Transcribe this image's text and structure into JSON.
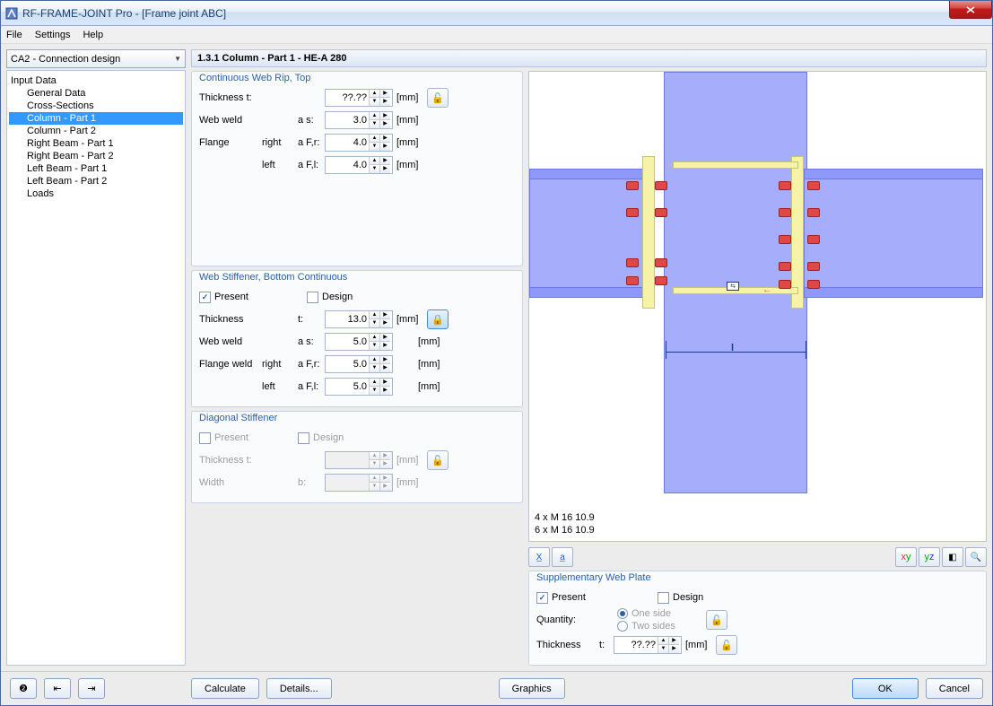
{
  "window": {
    "title": "RF-FRAME-JOINT Pro - [Frame joint ABC]"
  },
  "menu": {
    "file": "File",
    "settings": "Settings",
    "help": "Help"
  },
  "sidebar": {
    "combo": "CA2 - Connection design",
    "root": "Input Data",
    "items": [
      "General Data",
      "Cross-Sections",
      "Column - Part 1",
      "Column - Part 2",
      "Right Beam - Part 1",
      "Right Beam - Part 2",
      "Left Beam - Part 1",
      "Left Beam - Part 2",
      "Loads"
    ],
    "selected_index": 2
  },
  "heading": "1.3.1 Column - Part 1 - HE-A 280",
  "group1": {
    "title": "Continuous Web Rip, Top",
    "thickness_label": "Thickness t:",
    "thickness_value": "??.??",
    "webweld_label": "Web weld",
    "webweld_sym": "a s:",
    "webweld_value": "3.0",
    "flange_label": "Flange",
    "right": "right",
    "left": "left",
    "fr_sym": "a F,r:",
    "fl_sym": "a F,l:",
    "fr_value": "4.0",
    "fl_value": "4.0",
    "unit": "[mm]"
  },
  "group2": {
    "title": "Web Stiffener, Bottom Continuous",
    "present": "Present",
    "design": "Design",
    "thickness_label": "Thickness",
    "thickness_sym": "t:",
    "thickness_value": "13.0",
    "webweld_label": "Web weld",
    "webweld_sym": "a s:",
    "webweld_value": "5.0",
    "flangeweld_label": "Flange weld",
    "right": "right",
    "left": "left",
    "fr_sym": "a F,r:",
    "fl_sym": "a F,l:",
    "fr_value": "5.0",
    "fl_value": "5.0",
    "unit": "[mm]"
  },
  "group3": {
    "title": "Diagonal Stiffener",
    "present": "Present",
    "design": "Design",
    "thickness_label": "Thickness t:",
    "width_label": "Width",
    "width_sym": "b:",
    "unit": "[mm]"
  },
  "drawing": {
    "annot1": "4 x M 16 10.9",
    "annot2": "6 x M 16 10.9",
    "dim_label": "l"
  },
  "group4": {
    "title": "Supplementary Web Plate",
    "present": "Present",
    "design": "Design",
    "quantity": "Quantity:",
    "oneside": "One side",
    "twosides": "Two sides",
    "thickness_label": "Thickness",
    "thickness_sym": "t:",
    "thickness_value": "??.??",
    "unit": "[mm]"
  },
  "footer": {
    "calculate": "Calculate",
    "details": "Details...",
    "graphics": "Graphics",
    "ok": "OK",
    "cancel": "Cancel"
  }
}
